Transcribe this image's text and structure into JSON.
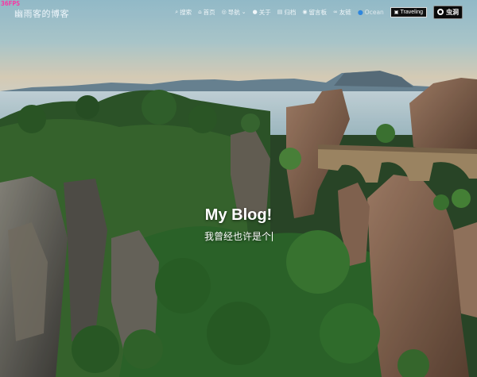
{
  "fps": "36FPS",
  "site_title": "幽雨客的博客",
  "nav": {
    "items": [
      {
        "icon": "search-icon",
        "glyph": "⌕",
        "label": "搜索"
      },
      {
        "icon": "home-icon",
        "glyph": "⌂",
        "label": "首页"
      },
      {
        "icon": "compass-icon",
        "glyph": "◎",
        "label": "导航"
      },
      {
        "icon": "user-icon",
        "glyph": "●",
        "label": "关于"
      },
      {
        "icon": "archive-icon",
        "glyph": "▤",
        "label": "归档"
      },
      {
        "icon": "chat-icon",
        "glyph": "◉",
        "label": "留言板"
      },
      {
        "icon": "link-icon",
        "glyph": "∞",
        "label": "友链"
      }
    ],
    "theme_label": "Ocean",
    "theme_icon": "water-drop-icon",
    "travel_label": "Traveling",
    "other_label": "虫洞"
  },
  "hero": {
    "title": "My Blog!",
    "subtitle": "我曾经也许是个"
  }
}
